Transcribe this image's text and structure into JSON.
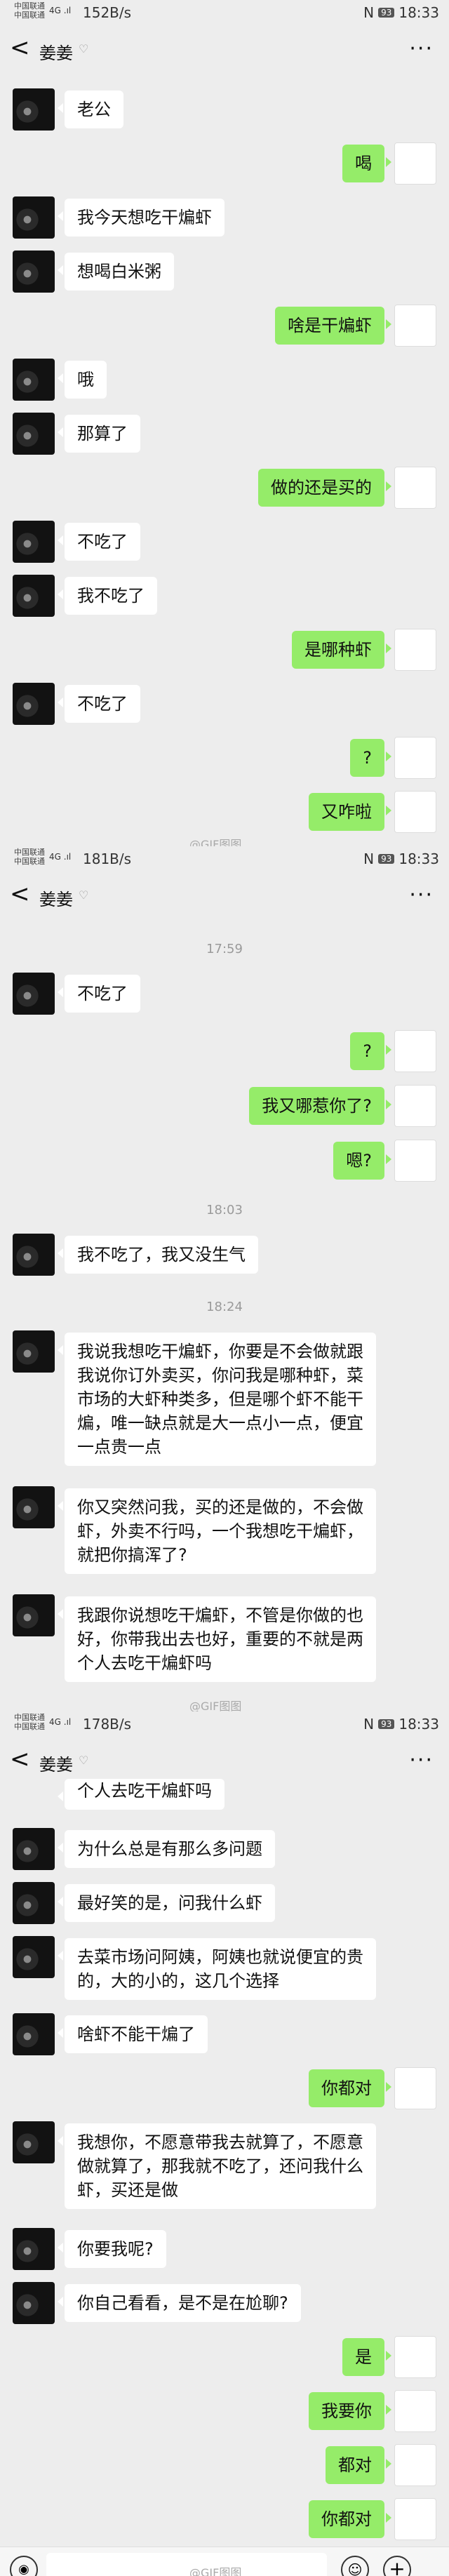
{
  "status": {
    "carrier1": "中国联通",
    "carrier2": "中国联通",
    "signal": "4G .ıl",
    "speed_p1": "152B/s",
    "speed_p2": "181B/s",
    "speed_p3": "178B/s",
    "nfc": "N",
    "battery": "93",
    "time": "18:33"
  },
  "chat": {
    "title": "姜姜",
    "back": "<",
    "pin": "♡",
    "more": "···"
  },
  "watermark": "@GIF图图",
  "timestamps": [
    "17:59",
    "18:03",
    "18:24"
  ],
  "messages": {
    "m1": "老公",
    "m2": "喝",
    "m3": "我今天想吃干煸虾",
    "m4": "想喝白米粥",
    "m5": "啥是干煸虾",
    "m6": "哦",
    "m7": "那算了",
    "m8": "做的还是买的",
    "m9": "不吃了",
    "m10": "我不吃了",
    "m11": "是哪种虾",
    "m12": "不吃了",
    "m13": "?",
    "m14": "又咋啦",
    "m15": "不吃了",
    "m16": "?",
    "m17": "我又哪惹你了?",
    "m18": "嗯?",
    "m19": "我不吃了，我又没生气",
    "m20": "我说我想吃干煸虾，你要是不会做就跟\n我说你订外卖买，你问我是哪种虾，菜\n市场的大虾种类多，但是哪个虾不能干\n煸，唯一缺点就是大一点小一点，便宜\n一点贵一点",
    "m21": "你又突然问我，买的还是做的，不会做\n虾，外卖不行吗，一个我想吃干煸虾，\n就把你搞浑了?",
    "m22": "我跟你说想吃干煸虾，不管是你做的也\n好，你带我出去也好，重要的不就是两\n个人去吃干煸虾吗",
    "m23": "个人去吃干煸虾吗",
    "m24": "为什么总是有那么多问题",
    "m25": "最好笑的是，问我什么虾",
    "m26": "去菜市场问阿姨，阿姨也就说便宜的贵\n的，大的小的，这几个选择",
    "m27": "啥虾不能干煸了",
    "m28": "你都对",
    "m29": "我想你，不愿意带我去就算了，不愿意\n做就算了，那我就不吃了，还问我什么\n虾，买还是做",
    "m30": "你要我呢?",
    "m31": "你自己看看，是不是在尬聊?",
    "m32": "是",
    "m33": "我要你",
    "m34": "都对",
    "m35": "你都对"
  }
}
